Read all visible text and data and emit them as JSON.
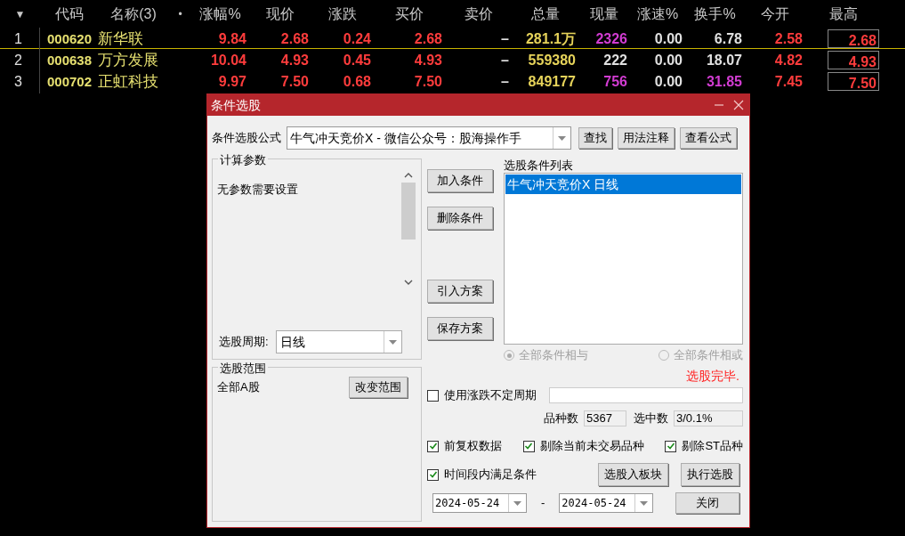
{
  "table": {
    "sort_icon": "▼",
    "columns": [
      {
        "label": "代码",
        "kind": "code"
      },
      {
        "label": "名称(3)",
        "kind": "name"
      },
      {
        "label": "•",
        "kind": "dot"
      },
      {
        "label": "涨幅%",
        "kind": "value"
      },
      {
        "label": "现价",
        "kind": "value"
      },
      {
        "label": "涨跌",
        "kind": "value"
      },
      {
        "label": "买价",
        "kind": "value"
      },
      {
        "label": "卖价",
        "kind": "value"
      },
      {
        "label": "总量",
        "kind": "value"
      },
      {
        "label": "现量",
        "kind": "value"
      },
      {
        "label": "涨速%",
        "kind": "value"
      },
      {
        "label": "换手%",
        "kind": "value"
      },
      {
        "label": "今开",
        "kind": "value"
      },
      {
        "label": "最高",
        "kind": "boxed"
      }
    ],
    "rows": [
      {
        "index": "1",
        "code": "000620",
        "name": "新华联",
        "selected": true,
        "values": [
          {
            "text": "9.84",
            "color": "#ff3c3c"
          },
          {
            "text": "2.68",
            "color": "#ff3c3c"
          },
          {
            "text": "0.24",
            "color": "#ff3c3c"
          },
          {
            "text": "2.68",
            "color": "#ff3c3c"
          },
          {
            "text": "–",
            "color": "#e0e0e0"
          },
          {
            "text": "281.1万",
            "color": "#e6d35a"
          },
          {
            "text": "2326",
            "color": "#d23cd2"
          },
          {
            "text": "0.00",
            "color": "#e0e0e0"
          },
          {
            "text": "6.78",
            "color": "#e0e0e0"
          },
          {
            "text": "2.58",
            "color": "#ff3c3c"
          },
          {
            "text": "2.68",
            "color": "#ff3c3c"
          }
        ]
      },
      {
        "index": "2",
        "code": "000638",
        "name": "万方发展",
        "selected": false,
        "values": [
          {
            "text": "10.04",
            "color": "#ff3c3c"
          },
          {
            "text": "4.93",
            "color": "#ff3c3c"
          },
          {
            "text": "0.45",
            "color": "#ff3c3c"
          },
          {
            "text": "4.93",
            "color": "#ff3c3c"
          },
          {
            "text": "–",
            "color": "#e0e0e0"
          },
          {
            "text": "559380",
            "color": "#e6d35a"
          },
          {
            "text": "222",
            "color": "#e0e0e0"
          },
          {
            "text": "0.00",
            "color": "#e0e0e0"
          },
          {
            "text": "18.07",
            "color": "#e0e0e0"
          },
          {
            "text": "4.82",
            "color": "#ff3c3c"
          },
          {
            "text": "4.93",
            "color": "#ff3c3c"
          }
        ]
      },
      {
        "index": "3",
        "code": "000702",
        "name": "正虹科技",
        "selected": false,
        "values": [
          {
            "text": "9.97",
            "color": "#ff3c3c"
          },
          {
            "text": "7.50",
            "color": "#ff3c3c"
          },
          {
            "text": "0.68",
            "color": "#ff3c3c"
          },
          {
            "text": "7.50",
            "color": "#ff3c3c"
          },
          {
            "text": "–",
            "color": "#e0e0e0"
          },
          {
            "text": "849177",
            "color": "#e6d35a"
          },
          {
            "text": "756",
            "color": "#d23cd2"
          },
          {
            "text": "0.00",
            "color": "#e0e0e0"
          },
          {
            "text": "31.85",
            "color": "#d23cd2"
          },
          {
            "text": "7.45",
            "color": "#ff3c3c"
          },
          {
            "text": "7.50",
            "color": "#ff3c3c"
          }
        ]
      }
    ]
  },
  "dialog": {
    "title": "条件选股",
    "formula": {
      "label": "条件选股公式",
      "value": "牛气冲天竞价X  -  微信公众号：股海操作手"
    },
    "top_buttons": [
      "查找",
      "用法注释",
      "查看公式"
    ],
    "params": {
      "title": "计算参数",
      "text": "无参数需要设置"
    },
    "period": {
      "label": "选股周期:",
      "value": "日线"
    },
    "range": {
      "title": "选股范围",
      "text": "全部A股",
      "button": "改变范围"
    },
    "side_buttons": [
      [
        "加入条件",
        "删除条件"
      ],
      [
        "引入方案",
        "保存方案"
      ]
    ],
    "conditions": {
      "title": "选股条件列表",
      "items": [
        {
          "text": "牛气冲天竞价X  日线",
          "selected": true
        }
      ]
    },
    "logic": [
      {
        "label": "全部条件相与",
        "selected": true,
        "disabled": true
      },
      {
        "label": "全部条件相或",
        "selected": false,
        "disabled": true
      }
    ],
    "status": "选股完毕.",
    "variable_period": {
      "label": "使用涨跌不定周期",
      "checked": false
    },
    "counts": [
      {
        "label": "品种数",
        "value": "5367"
      },
      {
        "label": "选中数",
        "value": "3/0.1%"
      }
    ],
    "options": [
      {
        "label": "前复权数据",
        "checked": true
      },
      {
        "label": "剔除当前未交易品种",
        "checked": true
      },
      {
        "label": "剔除ST品种",
        "checked": true
      }
    ],
    "time_range": {
      "label": "时间段内满足条件",
      "checked": true
    },
    "actions": [
      "选股入板块",
      "执行选股"
    ],
    "dates": {
      "from": "2024-05-24",
      "separator": "-",
      "to": "2024-05-24"
    },
    "close": "关闭"
  }
}
